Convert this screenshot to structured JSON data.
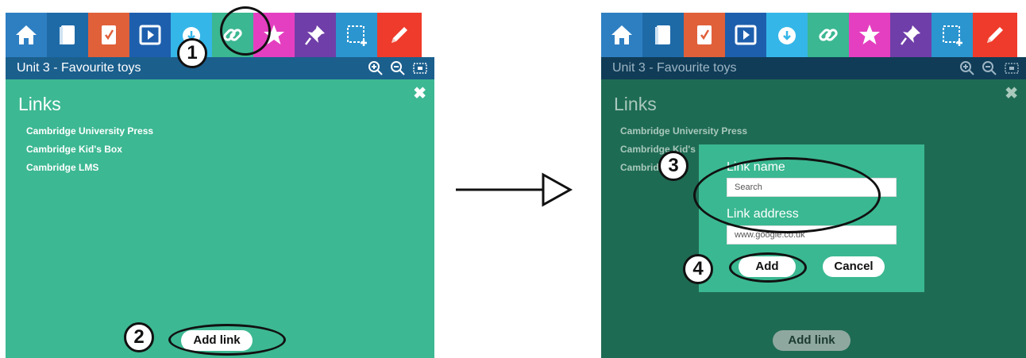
{
  "left": {
    "unit_title": "Unit 3 - Favourite toys",
    "heading": "Links",
    "close_glyph": "✖",
    "links": [
      "Cambridge University Press",
      "Cambridge Kid's Box",
      "Cambridge LMS"
    ],
    "add_link_label": "Add link",
    "markers": [
      "1",
      "2"
    ]
  },
  "right": {
    "unit_title": "Unit 3 - Favourite toys",
    "heading": "Links",
    "close_glyph": "✖",
    "links": [
      "Cambridge University Press",
      "Cambridge Kid's",
      "Cambrid"
    ],
    "add_link_label": "Add link",
    "dialog": {
      "name_label": "Link name",
      "name_value": "Search",
      "address_label": "Link address",
      "address_value": "www.google.co.uk",
      "add_label": "Add",
      "cancel_label": "Cancel"
    },
    "markers": [
      "3",
      "4"
    ]
  },
  "toolbar_icons": [
    "home-icon",
    "book-icon",
    "notebook-icon",
    "play-icon",
    "cloud-download-icon",
    "link-icon",
    "star-icon",
    "pin-icon",
    "select-icon",
    "pencil-icon"
  ],
  "colors": {
    "toolbar": [
      "#2e7fc2",
      "#1e6aa7",
      "#e0603a",
      "#1d5fad",
      "#35b6e8",
      "#3bb791",
      "#e43fc0",
      "#6f3ea8",
      "#2b95cf",
      "#ef3b2b"
    ],
    "subbar": "#1b5f8d",
    "panel_green": "#3cb892",
    "panel_dark": "#1e6b53",
    "subbar_dark": "#103c57"
  }
}
